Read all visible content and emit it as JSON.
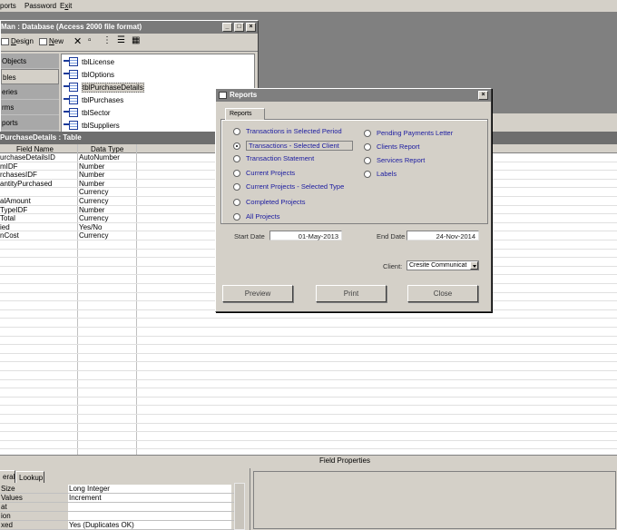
{
  "menubar": {
    "items": [
      "ports",
      "Password",
      "Exit"
    ]
  },
  "db_window": {
    "title": "Man : Database (Access 2000 file format)",
    "toolbar": {
      "design": "Design",
      "new": "New"
    },
    "objects_label": "Objects",
    "object_groups": [
      "bles",
      "eries",
      "rms",
      "ports"
    ],
    "tables": [
      "tblLicense",
      "tblOptions",
      "tblPurchaseDetails",
      "tblPurchases",
      "tblSector",
      "tblSuppliers"
    ],
    "selected_table": "tblPurchaseDetails"
  },
  "table_window": {
    "title": "PurchaseDetails : Table",
    "columns": {
      "field_name": "Field Name",
      "data_type": "Data Type"
    },
    "rows": [
      {
        "field": "urchaseDetailsID",
        "type": "AutoNumber"
      },
      {
        "field": "mIDF",
        "type": "Number"
      },
      {
        "field": "rchasesIDF",
        "type": "Number"
      },
      {
        "field": "antityPurchased",
        "type": "Number"
      },
      {
        "field": "",
        "type": "Currency"
      },
      {
        "field": "alAmount",
        "type": "Currency"
      },
      {
        "field": "TypeIDF",
        "type": "Number"
      },
      {
        "field": "Total",
        "type": "Currency"
      },
      {
        "field": "ied",
        "type": "Yes/No"
      },
      {
        "field": "nCost",
        "type": "Currency"
      }
    ],
    "field_properties_title": "Field Properties",
    "tabs": [
      "eral",
      "Lookup"
    ],
    "properties": [
      {
        "name": "Size",
        "value": "Long Integer"
      },
      {
        "name": "Values",
        "value": "Increment"
      },
      {
        "name": "at",
        "value": ""
      },
      {
        "name": "ion",
        "value": ""
      },
      {
        "name": "xed",
        "value": "Yes (Duplicates OK)"
      }
    ]
  },
  "dialog": {
    "title": "Reports",
    "tab": "Reports",
    "options_left": [
      {
        "label": "Transactions in Selected Period",
        "selected": false
      },
      {
        "label": "Transactions  - Selected Client",
        "selected": true
      },
      {
        "label": "Transaction Statement",
        "selected": false
      },
      {
        "label": "Current Projects",
        "selected": false
      },
      {
        "label": "Current Projects  - Selected Type",
        "selected": false
      },
      {
        "label": "Completed Projects",
        "selected": false
      },
      {
        "label": "All Projects",
        "selected": false
      }
    ],
    "options_right": [
      {
        "label": "Pending Payments Letter",
        "selected": false
      },
      {
        "label": "Clients Report",
        "selected": false
      },
      {
        "label": "Services Report",
        "selected": false
      },
      {
        "label": "Labels",
        "selected": false
      }
    ],
    "start_date_label": "Start Date",
    "start_date": "01-May-2013",
    "end_date_label": "End Date",
    "end_date": "24-Nov-2014",
    "client_label": "Client:",
    "client_value": "Cresite Communicat",
    "buttons": {
      "preview": "Preview",
      "print": "Print",
      "close": "Close"
    }
  }
}
